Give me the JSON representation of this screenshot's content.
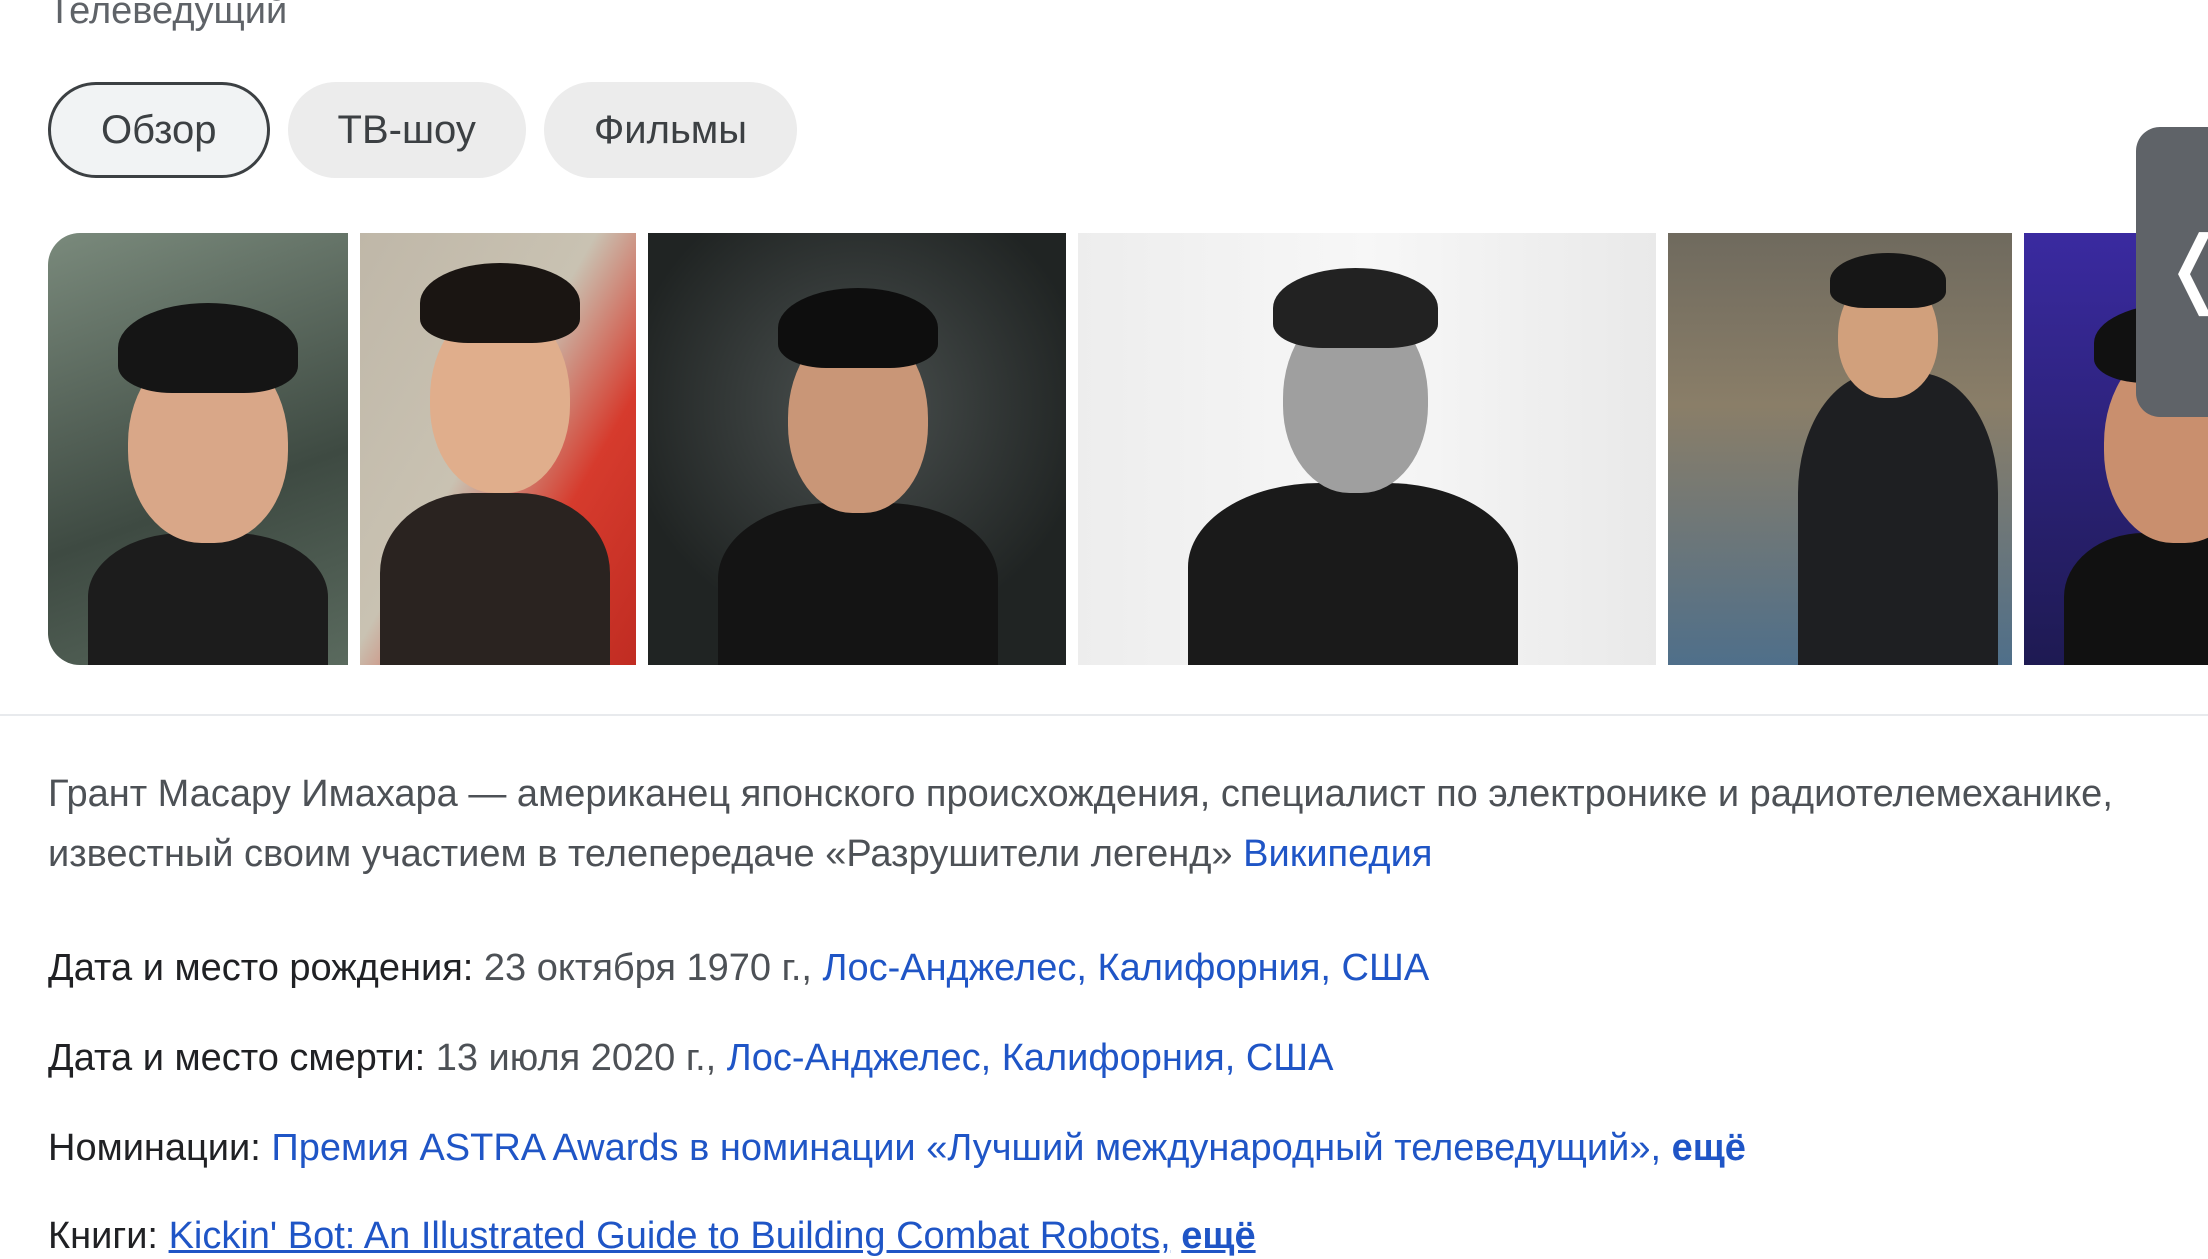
{
  "subtitle": "Телеведущий",
  "tabs": [
    {
      "label": "Обзор"
    },
    {
      "label": "ТВ-шоу"
    },
    {
      "label": "Фильмы"
    }
  ],
  "description": {
    "text": "Грант Масару Имахара — американец японского происхождения, специалист по электронике и радиотелемеханике, известный своим участием в телепередаче «Разрушители легенд»",
    "source_link": "Википедия"
  },
  "facts": {
    "birth": {
      "label": "Дата и место рождения:",
      "date": "23 октября 1970 г.,",
      "place": "Лос-Анджелес, Калифорния, США"
    },
    "death": {
      "label": "Дата и место смерти:",
      "date": "13 июля 2020 г.,",
      "place": "Лос-Анджелес, Калифорния, США"
    },
    "nominations": {
      "label": "Номинации:",
      "value": "Премия ASTRA Awards в номинации «Лучший международный телеведущий»,",
      "more": "ещё"
    },
    "books": {
      "label": "Книги:",
      "value": "Kickin' Bot: An Illustrated Guide to Building Combat Robots,",
      "more": "ещё"
    }
  },
  "icons": {
    "side_handle": "chevron-left-icon"
  }
}
